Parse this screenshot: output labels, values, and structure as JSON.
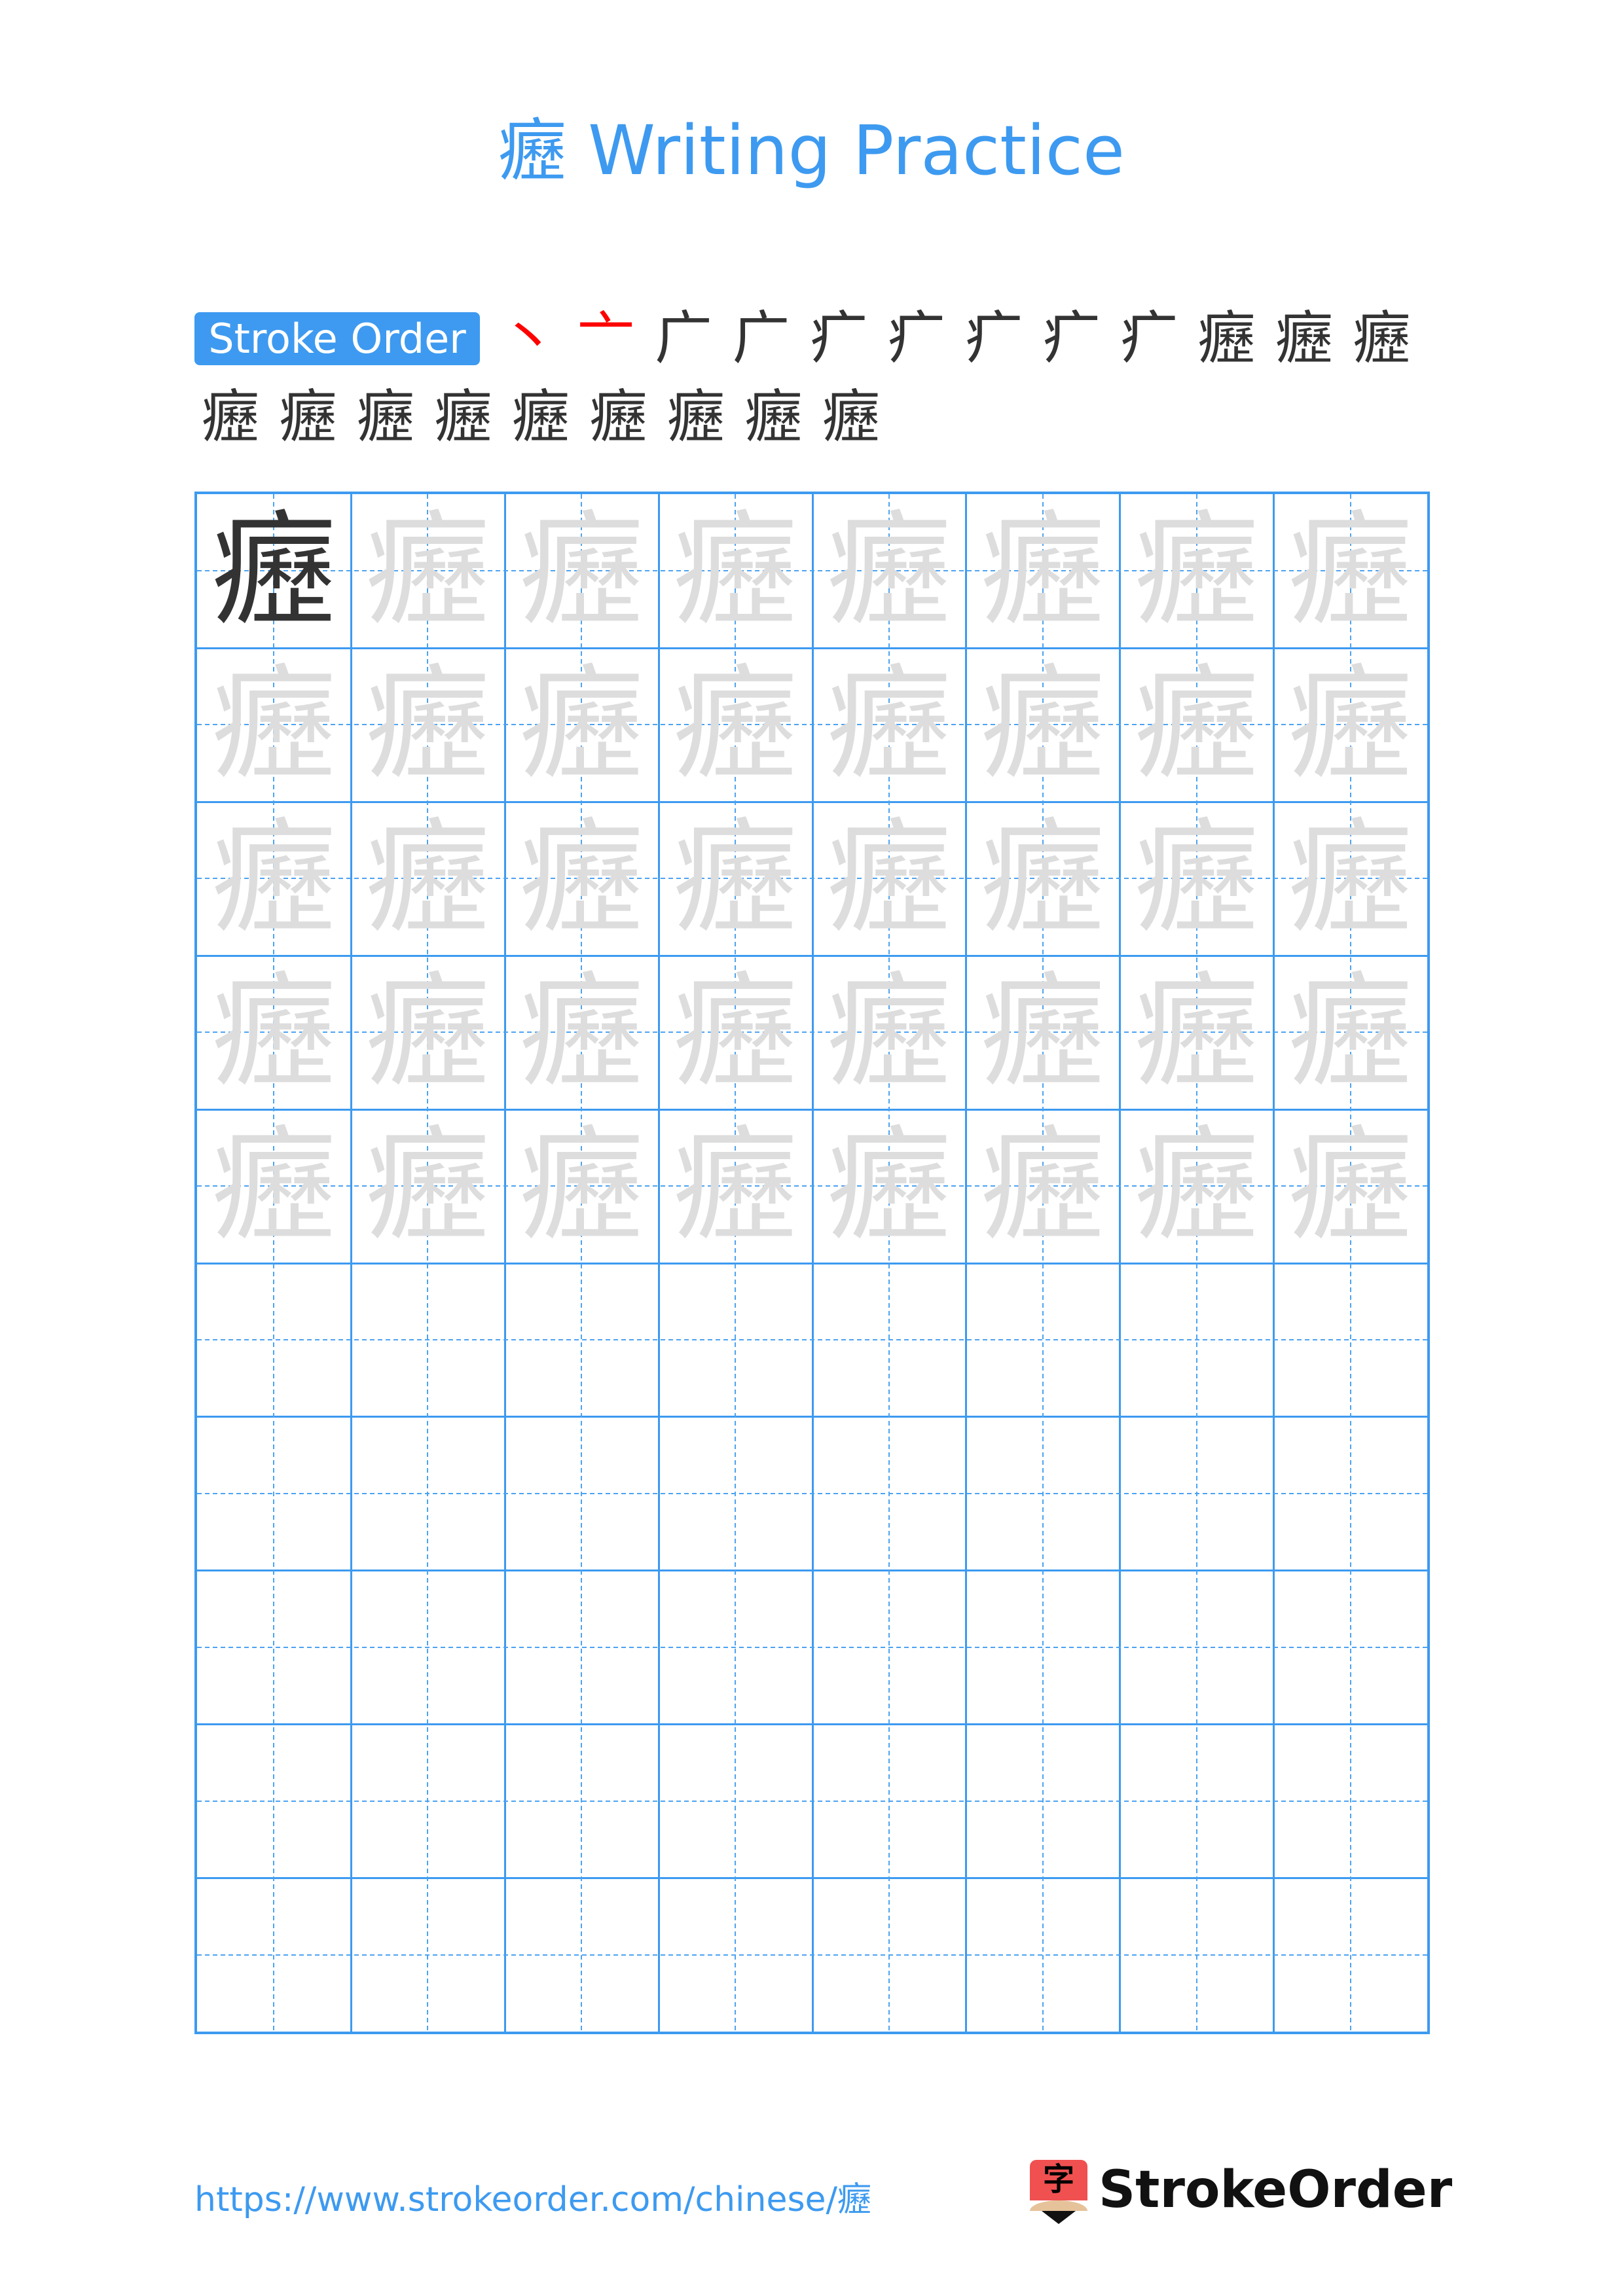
{
  "header": {
    "character": "癧",
    "title": "癧 Writing Practice"
  },
  "stroke_order": {
    "label": "Stroke Order",
    "total_strokes": 21,
    "highlight_color": "#ff0000",
    "stroke_color": "#333333",
    "steps": [
      {
        "step": 1,
        "glyph": "丶"
      },
      {
        "step": 2,
        "glyph": "亠"
      },
      {
        "step": 3,
        "glyph": "广"
      },
      {
        "step": 4,
        "glyph": "广"
      },
      {
        "step": 5,
        "glyph": "疒"
      },
      {
        "step": 6,
        "glyph": "疒"
      },
      {
        "step": 7,
        "glyph": "疒"
      },
      {
        "step": 8,
        "glyph": "疒"
      },
      {
        "step": 9,
        "glyph": "疒"
      },
      {
        "step": 10,
        "glyph": "癧"
      },
      {
        "step": 11,
        "glyph": "癧"
      },
      {
        "step": 12,
        "glyph": "癧"
      },
      {
        "step": 13,
        "glyph": "癧"
      },
      {
        "step": 14,
        "glyph": "癧"
      },
      {
        "step": 15,
        "glyph": "癧"
      },
      {
        "step": 16,
        "glyph": "癧"
      },
      {
        "step": 17,
        "glyph": "癧"
      },
      {
        "step": 18,
        "glyph": "癧"
      },
      {
        "step": 19,
        "glyph": "癧"
      },
      {
        "step": 20,
        "glyph": "癧"
      },
      {
        "step": 21,
        "glyph": "癧"
      }
    ]
  },
  "practice_grid": {
    "columns": 8,
    "rows": 10,
    "character": "癧",
    "model_cells": 1,
    "trace_rows": 5,
    "empty_rows": 5,
    "line_color": "#3d9af0",
    "trace_color": "#dddddd",
    "model_color": "#333333"
  },
  "footer": {
    "url": "https://www.strokeorder.com/chinese/癧",
    "logo_glyph": "字",
    "brand": "StrokeOrder"
  }
}
